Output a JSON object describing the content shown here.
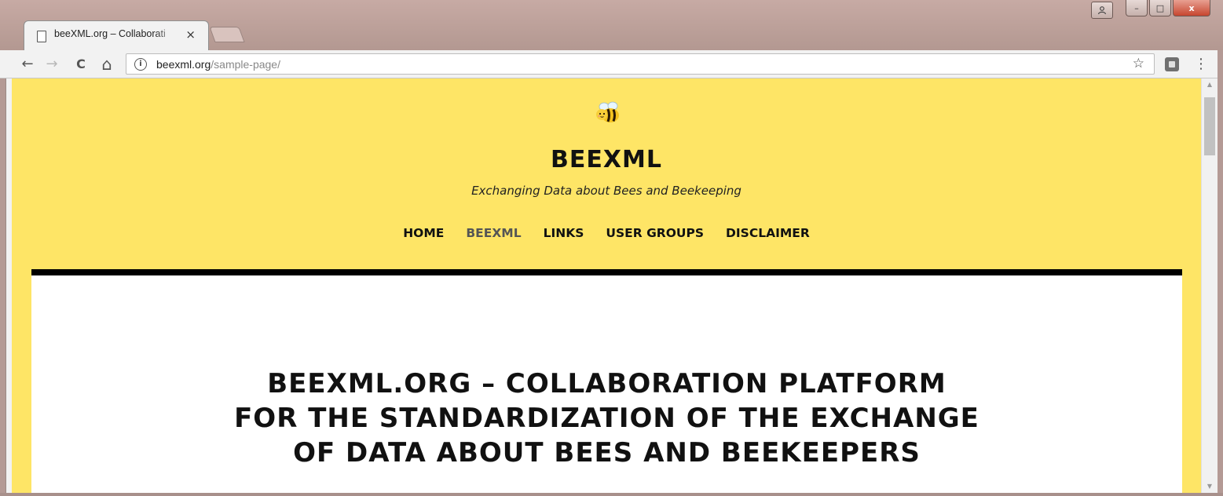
{
  "browser": {
    "tab_title": "beeXML.org – Collaborati",
    "tab_close": "×",
    "url_domain": "beexml.org",
    "url_path": "/sample-page/",
    "back_icon": "←",
    "forward_icon": "→",
    "reload_icon": "C",
    "home_icon": "⌂",
    "info_icon": "i",
    "star_icon": "☆",
    "menu_icon": "⋮",
    "win_minimize": "–",
    "win_maximize": "□",
    "win_close": "x"
  },
  "site": {
    "title": "BEEXML",
    "tagline": "Exchanging Data about Bees and Beekeeping",
    "nav": [
      "HOME",
      "BEEXML",
      "LINKS",
      "USER GROUPS",
      "DISCLAIMER"
    ],
    "active_nav": "BEEXML",
    "headline_lines": [
      "BEEXML.ORG – COLLABORATION PLATFORM",
      "FOR THE STANDARDIZATION OF THE EXCHANGE",
      "OF DATA ABOUT BEES AND BEEKEEPERS"
    ],
    "colors": {
      "background": "#fee566",
      "rule": "#000000"
    }
  }
}
